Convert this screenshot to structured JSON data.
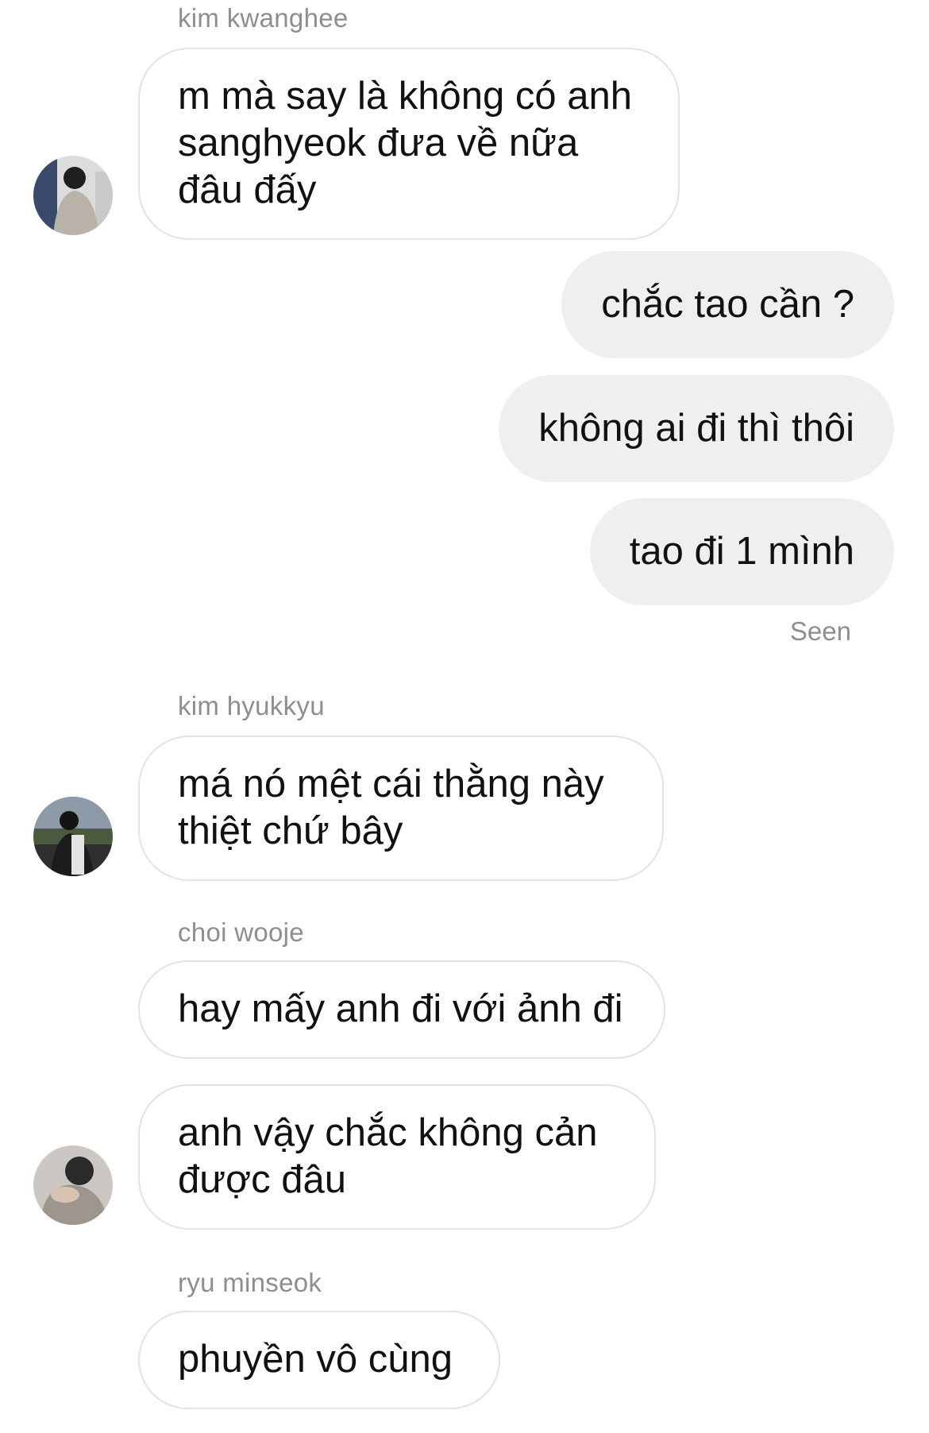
{
  "thread": {
    "messages": [
      {
        "sender": "kim kwanghee",
        "text": "m mà say là không có anh sanghyeok đưa về nữa đâu đấy"
      },
      {
        "text": "chắc tao cần ?"
      },
      {
        "text": "không ai đi thì thôi"
      },
      {
        "text": "tao đi 1 mình"
      },
      {
        "sender": "kim hyukkyu",
        "text": "má nó mệt cái thằng này thiệt chứ bây"
      },
      {
        "sender": "choi wooje",
        "text": "hay mấy anh đi với ảnh đi"
      },
      {
        "text": "anh vậy chắc không cản được đâu"
      },
      {
        "sender": "ryu minseok",
        "text": "phuyền vô cùng"
      }
    ],
    "seen_label": "Seen"
  },
  "colors": {
    "incoming_bubble_border": "#e3e3e3",
    "outgoing_bubble_bg": "#efefef",
    "meta_text": "#8e8e8e"
  },
  "avatars": [
    "avatar-kim-kwanghee",
    "avatar-kim-hyukkyu",
    "avatar-choi-wooje"
  ]
}
